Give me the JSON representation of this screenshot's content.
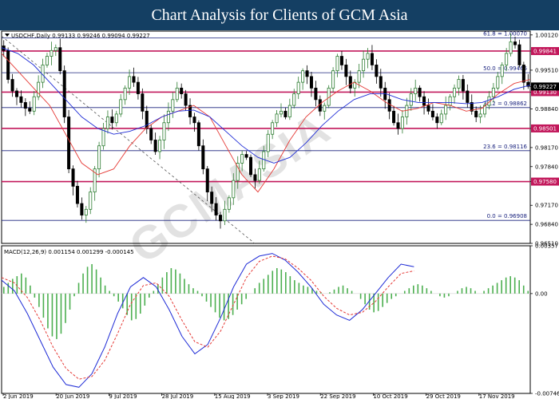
{
  "header": {
    "title": "Chart Analysis for Clients of GCM Asia"
  },
  "watermark": "GCMASIA",
  "colors": {
    "up_candle": "#2e7d32",
    "down_candle": "#000000",
    "ma_fast": "#e53935",
    "ma_slow": "#1e2bd6",
    "fib_line": "#1a237e",
    "sr_line": "#c2185b",
    "macd_hist": "#4caf50",
    "macd_line": "#1e2bd6",
    "signal_line": "#e53935",
    "banner": "#143f63"
  },
  "chart_data": [
    {
      "type": "candlestick",
      "legend": "USDCHF,Daily  0.99133 0.99246 0.99094 0.99227",
      "ylim": [
        0.9651,
        1.002
      ],
      "y_ticks": [
        "1.00120",
        "0.99841",
        "0.99510",
        "0.99227",
        "0.99130",
        "0.98840",
        "0.98501",
        "0.98170",
        "0.97840",
        "0.97580",
        "0.97170",
        "0.96840",
        "0.96510"
      ],
      "x_labels": [
        "2 Jun 2019",
        "20 Jun 2019",
        "9 Jul 2019",
        "28 Jul 2019",
        "15 Aug 2019",
        "3 Sep 2019",
        "22 Sep 2019",
        "10 Oct 2019",
        "29 Oct 2019",
        "17 Nov 2019"
      ],
      "fib_levels": [
        {
          "label": "61.8 = 1.00070",
          "value": 1.0007
        },
        {
          "label": "50.0 = 0.99466",
          "value": 0.99466
        },
        {
          "label": "38.2 = 0.98862",
          "value": 0.98862
        },
        {
          "label": "23.6 = 0.98116",
          "value": 0.98116
        },
        {
          "label": "0.0 = 0.96908",
          "value": 0.96908
        }
      ],
      "sr_levels": [
        {
          "label": "0.99841",
          "value": 0.99841
        },
        {
          "label": "0.99130",
          "value": 0.9913
        },
        {
          "label": "0.98501",
          "value": 0.98501
        },
        {
          "label": "0.97580",
          "value": 0.9758
        }
      ],
      "current_price": {
        "label": "0.99227",
        "value": 0.99227
      },
      "close_path": [
        0.9985,
        0.9935,
        0.9915,
        0.9905,
        0.9895,
        0.9885,
        0.988,
        0.9905,
        0.993,
        0.996,
        0.9975,
        0.9985,
        0.999,
        0.995,
        0.987,
        0.978,
        0.975,
        0.972,
        0.97,
        0.971,
        0.974,
        0.978,
        0.982,
        0.985,
        0.987,
        0.986,
        0.9875,
        0.99,
        0.992,
        0.994,
        0.993,
        0.991,
        0.988,
        0.985,
        0.983,
        0.981,
        0.983,
        0.986,
        0.988,
        0.99,
        0.992,
        0.991,
        0.989,
        0.987,
        0.986,
        0.982,
        0.978,
        0.974,
        0.972,
        0.97,
        0.969,
        0.971,
        0.973,
        0.976,
        0.979,
        0.9805,
        0.98,
        0.977,
        0.976,
        0.978,
        0.981,
        0.984,
        0.986,
        0.9875,
        0.988,
        0.987,
        0.989,
        0.991,
        0.993,
        0.995,
        0.994,
        0.992,
        0.99,
        0.988,
        0.989,
        0.992,
        0.995,
        0.9975,
        0.996,
        0.994,
        0.992,
        0.993,
        0.995,
        0.997,
        0.998,
        0.996,
        0.994,
        0.992,
        0.99,
        0.988,
        0.986,
        0.985,
        0.987,
        0.989,
        0.991,
        0.992,
        0.9905,
        0.989,
        0.988,
        0.987,
        0.986,
        0.9875,
        0.989,
        0.9905,
        0.992,
        0.9935,
        0.9915,
        0.9895,
        0.988,
        0.987,
        0.9875,
        0.989,
        0.9905,
        0.992,
        0.994,
        0.996,
        0.998,
        1.0,
        0.9995,
        0.996,
        0.993,
        0.9923
      ],
      "moving_averages": [
        {
          "name": "MA fast",
          "values": [
            0.998,
            0.995,
            0.992,
            0.989,
            0.984,
            0.979,
            0.977,
            0.978,
            0.982,
            0.985,
            0.987,
            0.988,
            0.989,
            0.987,
            0.982,
            0.977,
            0.974,
            0.978,
            0.983,
            0.987,
            0.9895,
            0.9915,
            0.993,
            0.9915,
            0.9895,
            0.988,
            0.9885,
            0.9895,
            0.989,
            0.988,
            0.9885,
            0.991,
            0.9928,
            0.9935
          ]
        },
        {
          "name": "MA slow",
          "values": [
            0.999,
            0.998,
            0.996,
            0.993,
            0.99,
            0.987,
            0.985,
            0.984,
            0.9845,
            0.9855,
            0.987,
            0.988,
            0.9882,
            0.987,
            0.9845,
            0.982,
            0.98,
            0.979,
            0.98,
            0.9825,
            0.9855,
            0.988,
            0.99,
            0.991,
            0.991,
            0.99,
            0.9895,
            0.9895,
            0.9895,
            0.9893,
            0.9895,
            0.9905,
            0.9918,
            0.9925
          ]
        }
      ],
      "trendline": {
        "from": [
          0.0,
          1.001
        ],
        "to": [
          0.48,
          0.965
        ]
      }
    },
    {
      "type": "bar",
      "legend": "MACD(12,26,9)  0.001154 0.001299 -0.000145",
      "ylim": [
        -0.00746,
        0.00357
      ],
      "y_ticks": [
        "0.00357",
        "0.00",
        "-0.00746"
      ],
      "histogram": [
        0.0005,
        0.0008,
        0.0011,
        0.0013,
        0.0015,
        0.0012,
        0.0006,
        -0.0003,
        -0.001,
        -0.0018,
        -0.0026,
        -0.0032,
        -0.0034,
        -0.003,
        -0.0022,
        -0.0012,
        -0.0002,
        0.0008,
        0.0015,
        0.002,
        0.0022,
        0.0018,
        0.0012,
        0.0006,
        0.0002,
        -0.0002,
        -0.0006,
        -0.0011,
        -0.0016,
        -0.002,
        -0.0019,
        -0.0015,
        -0.0009,
        -0.0003,
        0.0002,
        0.0007,
        0.0012,
        0.0016,
        0.0019,
        0.0018,
        0.0015,
        0.0011,
        0.0007,
        0.0004,
        0.0002,
        -0.0002,
        -0.0006,
        -0.001,
        -0.0014,
        -0.0018,
        -0.002,
        -0.0019,
        -0.0016,
        -0.0012,
        -0.0008,
        -0.0004,
        0.0,
        0.0004,
        0.0008,
        0.0011,
        0.0014,
        0.0017,
        0.0019,
        0.0018,
        0.0016,
        0.0013,
        0.001,
        0.0008,
        0.0006,
        0.0005,
        0.0004,
        0.0002,
        0.0001,
        0.0,
        0.0001,
        0.0003,
        0.0005,
        0.0006,
        0.0004,
        0.0002,
        0.0,
        -0.0004,
        -0.0008,
        -0.0012,
        -0.0014,
        -0.0013,
        -0.001,
        -0.0007,
        -0.0004,
        -0.0002,
        0.0,
        0.0002,
        0.0004,
        0.0006,
        0.0007,
        0.0006,
        0.0004,
        0.0002,
        0.0,
        -0.0002,
        -0.0003,
        -0.0002,
        0.0,
        0.0002,
        0.0004,
        0.0005,
        0.0004,
        0.0002,
        0.0,
        0.0002,
        0.0004,
        0.0006,
        0.0008,
        0.001,
        0.0012,
        0.0013,
        0.0012,
        0.001,
        0.0006,
        0.0002
      ],
      "macd_line": [
        0.001,
        0.0002,
        -0.0015,
        -0.0035,
        -0.0055,
        -0.0068,
        -0.007,
        -0.006,
        -0.004,
        -0.0015,
        0.0005,
        0.0012,
        0.0005,
        -0.0012,
        -0.0032,
        -0.0045,
        -0.0038,
        -0.0018,
        0.0005,
        0.0022,
        0.0028,
        0.003,
        0.0025,
        0.0016,
        0.0005,
        -0.0008,
        -0.0016,
        -0.002,
        -0.0012,
        0.0,
        0.0012,
        0.0022,
        0.002
      ],
      "signal_line": [
        0.0012,
        0.0008,
        -0.0003,
        -0.002,
        -0.004,
        -0.0056,
        -0.0064,
        -0.0062,
        -0.005,
        -0.003,
        -0.0008,
        0.0006,
        0.0008,
        -0.0002,
        -0.002,
        -0.0036,
        -0.004,
        -0.0028,
        -0.0008,
        0.0012,
        0.0024,
        0.0028,
        0.0026,
        0.0019,
        0.001,
        -0.0002,
        -0.0011,
        -0.0016,
        -0.0014,
        -0.0006,
        0.0005,
        0.0015,
        0.0017
      ]
    }
  ]
}
